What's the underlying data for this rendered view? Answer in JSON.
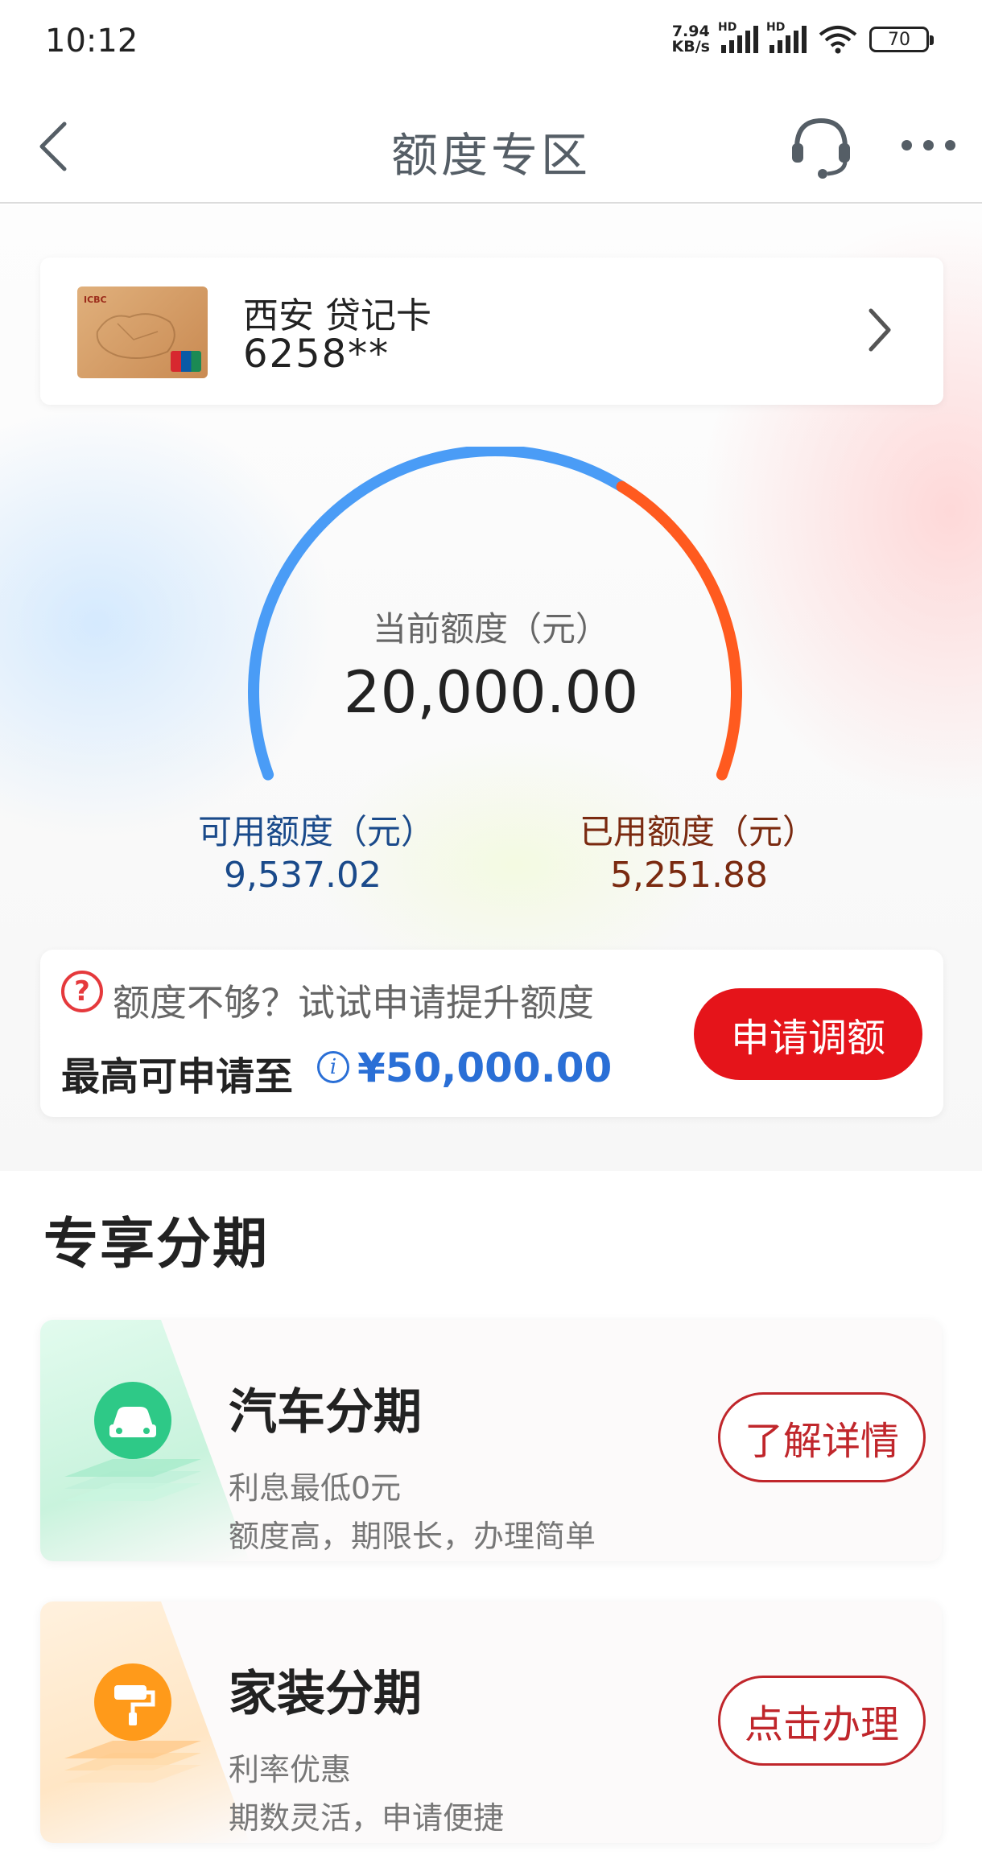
{
  "status_bar": {
    "time": "10:12",
    "net_speed_value": "7.94",
    "net_speed_unit": "KB/s",
    "signal_label": "HD",
    "battery": "70"
  },
  "header": {
    "title": "额度专区"
  },
  "card": {
    "name": "西安 贷记卡",
    "number": "6258**"
  },
  "gauge": {
    "label": "当前额度（元）",
    "value": "20,000.00",
    "available_label": "可用额度（元）",
    "available_value": "9,537.02",
    "used_label": "已用额度（元）",
    "used_value": "5,251.88",
    "used_fraction": 0.356,
    "available_color": "#4a9cf6",
    "used_color": "#ff5a1f"
  },
  "increase": {
    "prompt": "额度不够？试试申请提升额度",
    "max_label": "最高可申请至",
    "max_value": "¥50,000.00",
    "button": "申请调额",
    "button_color": "#e5141a"
  },
  "section": {
    "title": "专享分期"
  },
  "promos": [
    {
      "title": "汽车分期",
      "sub1": "利息最低0元",
      "sub2": "额度高，期限长，办理简单",
      "button": "了解详情",
      "icon": "car-icon",
      "accent": "#2ec987"
    },
    {
      "title": "家装分期",
      "sub1": "利率优惠",
      "sub2": "期数灵活，申请便捷",
      "button": "点击办理",
      "icon": "paint-roller-icon",
      "accent": "#ff9a1a"
    }
  ]
}
